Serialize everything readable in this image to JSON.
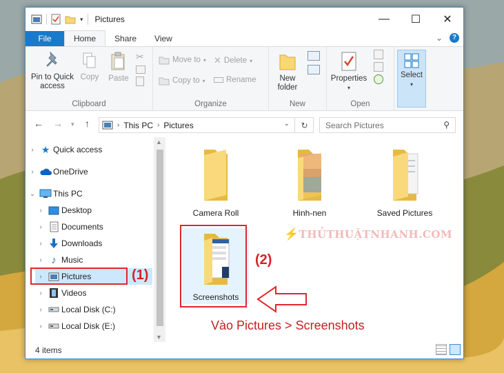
{
  "window": {
    "title": "Pictures",
    "controls": {
      "minimize": "—",
      "maximize": "☐",
      "close": "✕"
    }
  },
  "tabs": {
    "file": "File",
    "home": "Home",
    "share": "Share",
    "view": "View"
  },
  "ribbon": {
    "clipboard": {
      "label": "Clipboard",
      "pin": "Pin to Quick access",
      "copy": "Copy",
      "paste": "Paste"
    },
    "organize": {
      "label": "Organize",
      "move_to": "Move to",
      "copy_to": "Copy to",
      "delete": "Delete",
      "rename": "Rename"
    },
    "new": {
      "label": "New",
      "new_folder": "New folder"
    },
    "open": {
      "label": "Open",
      "properties": "Properties"
    },
    "select": {
      "label": "Select"
    }
  },
  "address": {
    "crumbs": [
      "This PC",
      "Pictures"
    ],
    "search_placeholder": "Search Pictures"
  },
  "nav_pane": {
    "items": [
      {
        "label": "Quick access"
      },
      {
        "label": "OneDrive"
      },
      {
        "label": "This PC"
      },
      {
        "label": "Desktop"
      },
      {
        "label": "Documents"
      },
      {
        "label": "Downloads"
      },
      {
        "label": "Music"
      },
      {
        "label": "Pictures"
      },
      {
        "label": "Videos"
      },
      {
        "label": "Local Disk (C:)"
      },
      {
        "label": "Local Disk (E:)"
      }
    ]
  },
  "folders": [
    {
      "label": "Camera Roll"
    },
    {
      "label": "Hinh-nen"
    },
    {
      "label": "Saved Pictures"
    },
    {
      "label": "Screenshots"
    }
  ],
  "status": {
    "items": "4 items"
  },
  "annotations": {
    "step1": "(1)",
    "step2": "(2)",
    "caption": "Vào Pictures > Screenshots",
    "watermark": "THỦTHUẬTNHANH.COM"
  },
  "colors": {
    "accent": "#1979ca",
    "annotation_red": "#e0262b",
    "selection": "#cce8ff",
    "folder": "#f8d775"
  }
}
